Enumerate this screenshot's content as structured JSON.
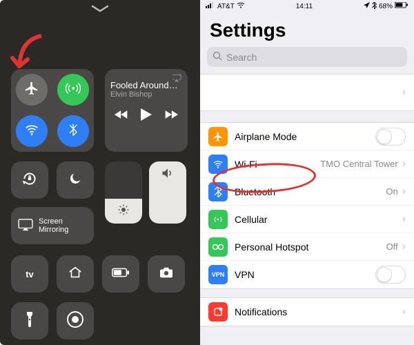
{
  "controlCenter": {
    "connectivity": {
      "airplane": {
        "bg": "#6f6d6a",
        "glyph": "airplane"
      },
      "cellular": {
        "bg": "#36c759",
        "glyph": "antenna"
      },
      "wifi": {
        "bg": "#2e7ff6",
        "glyph": "wifi"
      },
      "bluetooth": {
        "bg": "#2e7ff6",
        "glyph": "bluetooth"
      }
    },
    "nowPlaying": {
      "title": "Fooled Around…",
      "artist": "Elvin Bishop"
    },
    "screenMirroring": "Screen Mirroring"
  },
  "settings": {
    "statusBar": {
      "carrier": "AT&T",
      "time": "14:11",
      "battery": "68%"
    },
    "title": "Settings",
    "searchPlaceholder": "Search",
    "rows": {
      "airplane": {
        "label": "Airplane Mode",
        "iconBg": "#ff9500"
      },
      "wifi": {
        "label": "Wi-Fi",
        "iconBg": "#2e7ff6",
        "value": "TMO Central Tower"
      },
      "bluetooth": {
        "label": "Bluetooth",
        "iconBg": "#2e7ff6",
        "value": "On"
      },
      "cellular": {
        "label": "Cellular",
        "iconBg": "#36c759"
      },
      "hotspot": {
        "label": "Personal Hotspot",
        "iconBg": "#36c759",
        "value": "Off"
      },
      "vpn": {
        "label": "VPN",
        "iconBg": "#2e7ff6",
        "text": "VPN"
      },
      "notif": {
        "label": "Notifications",
        "iconBg": "#ff3b30"
      }
    }
  }
}
